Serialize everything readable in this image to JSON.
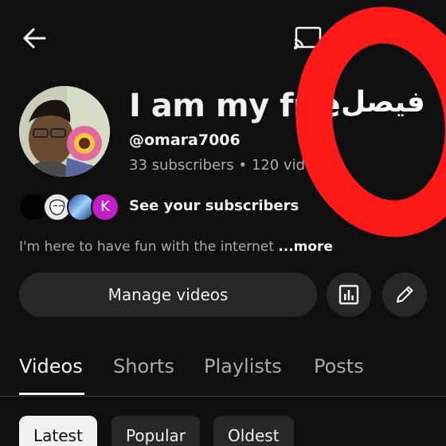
{
  "header": {
    "back_icon": "arrow-left-icon",
    "cast_icon": "cast-icon"
  },
  "channel": {
    "title": "I am my frie",
    "handle": "@omara7006",
    "stats": "33 subscribers • 120 video"
  },
  "overlay": {
    "text": "فيصل",
    "ring_color": "#ff1a1a"
  },
  "subscribers": {
    "avatar_initial": "K",
    "label": "See your subscribers"
  },
  "description": {
    "text": "I'm here to have fun with the internet ",
    "more_label": "...more"
  },
  "actions": {
    "manage_label": "Manage videos",
    "analytics_icon": "analytics-icon",
    "edit_icon": "pencil-icon"
  },
  "tabs": [
    {
      "label": "Videos",
      "active": true
    },
    {
      "label": "Shorts",
      "active": false
    },
    {
      "label": "Playlists",
      "active": false
    },
    {
      "label": "Posts",
      "active": false
    }
  ],
  "filters": [
    {
      "label": "Latest",
      "active": true
    },
    {
      "label": "Popular",
      "active": false
    },
    {
      "label": "Oldest",
      "active": false
    }
  ],
  "colors": {
    "background": "#0f0f0f",
    "surface": "#272727",
    "text": "#f1f1f1",
    "secondary_text": "#aaaaaa",
    "accent_pink": "#c21fc9"
  }
}
